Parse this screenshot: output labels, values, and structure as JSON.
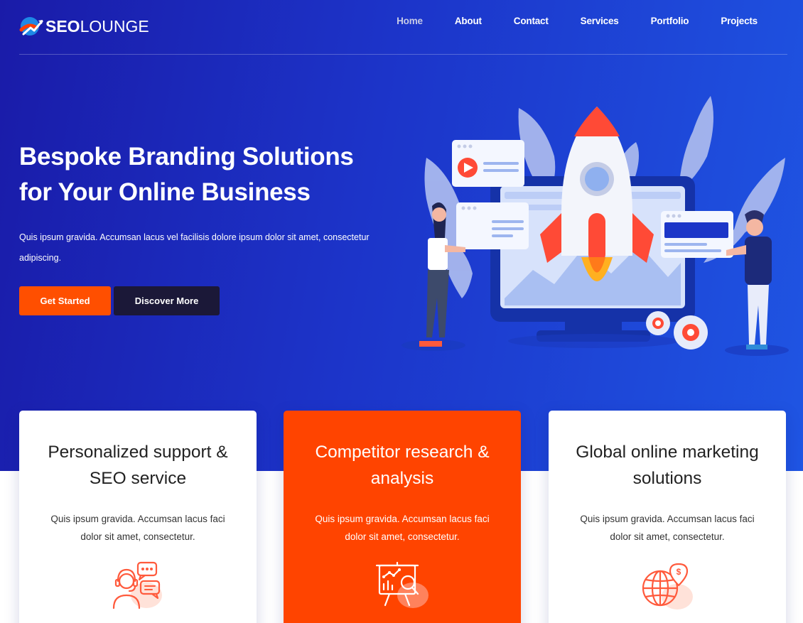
{
  "brand": {
    "name_bold": "SEO",
    "name_light": "LOUNGE"
  },
  "nav": {
    "items": [
      "Home",
      "About",
      "Contact",
      "Services",
      "Portfolio",
      "Projects"
    ],
    "active": "Home"
  },
  "hero": {
    "title_line1": "Bespoke Branding Solutions",
    "title_line2": "for Your Online Business",
    "description_line1": "Quis ipsum gravida. Accumsan lacus vel facilisis dolore ipsum dolor sit amet, consectetur",
    "description_line2": "adipiscing.",
    "primary_button": "Get Started",
    "secondary_button": "Discover More"
  },
  "cards": [
    {
      "title_line1": "Personalized support &",
      "title_line2": "SEO service",
      "text_line1": "Quis ipsum gravida. Accumsan lacus faci",
      "text_line2": "dolor sit amet, consectetur.",
      "icon": "customer-support-icon"
    },
    {
      "title_line1": "Competitor research &",
      "title_line2": "analysis",
      "text_line1": "Quis ipsum gravida. Accumsan lacus faci",
      "text_line2": "dolor sit amet, consectetur.",
      "icon": "presentation-analysis-icon"
    },
    {
      "title_line1": "Global online marketing",
      "title_line2": "solutions",
      "text_line1": "Quis ipsum gravida. Accumsan lacus faci",
      "text_line2": "dolor sit amet, consectetur.",
      "icon": "global-money-icon"
    }
  ],
  "colors": {
    "hero_start": "#1a1ba8",
    "hero_end": "#1f55e3",
    "accent": "#ff4f00",
    "dark_button": "#1b1838",
    "card_highlight": "#ff4400"
  }
}
